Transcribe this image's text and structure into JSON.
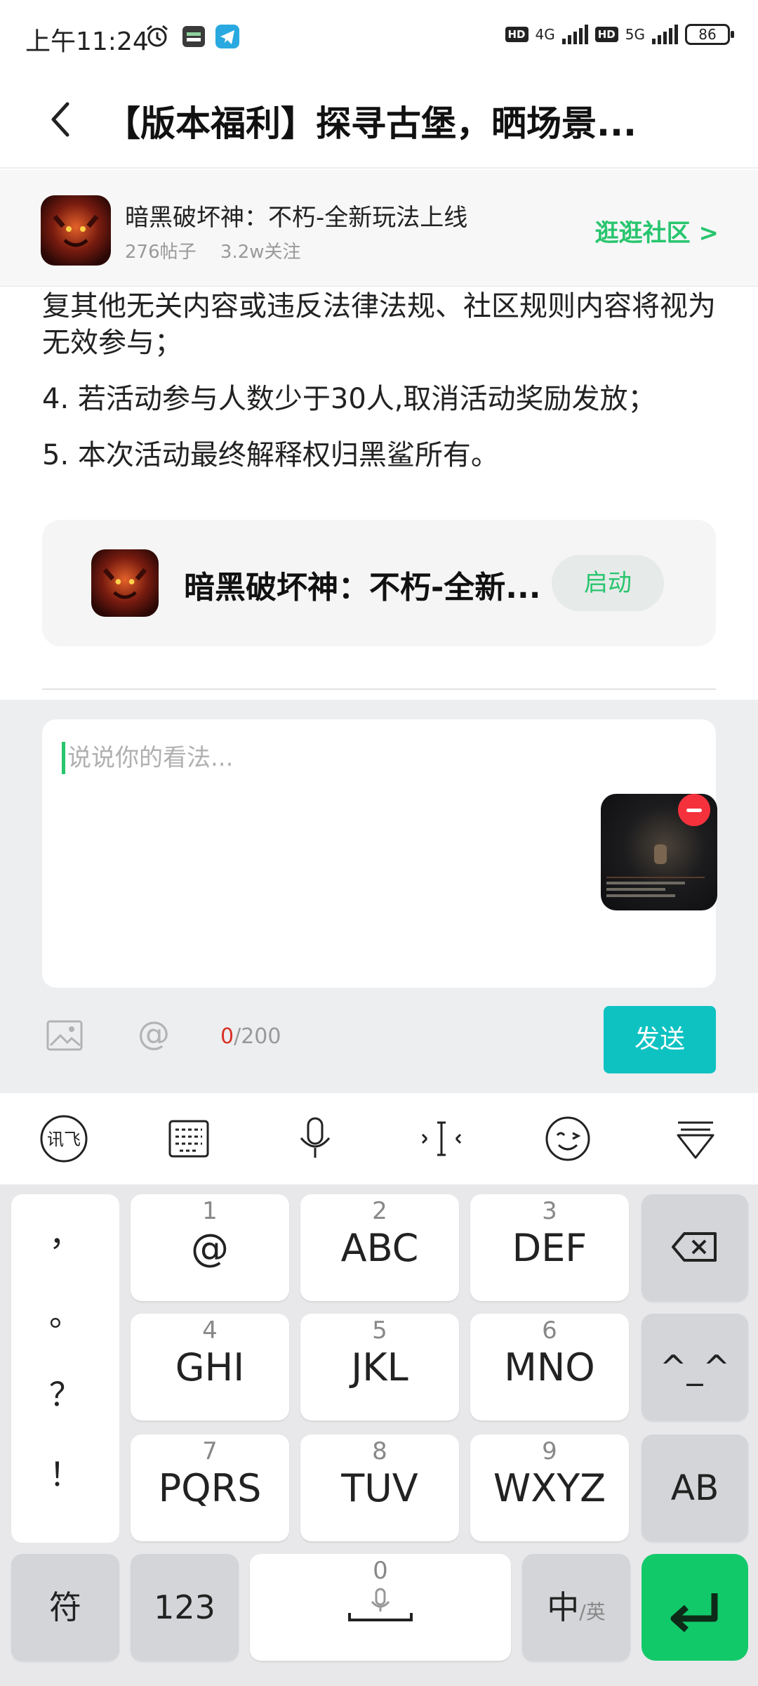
{
  "status_bar": {
    "time": "上午11:24",
    "net1": "4G",
    "net2": "5G",
    "hd": "HD",
    "battery": "86"
  },
  "header": {
    "title": "【版本福利】探寻古堡，晒场景..."
  },
  "community": {
    "name": "暗黑破坏神：不朽-全新玩法上线",
    "posts": "276帖子",
    "followers": "3.2w关注",
    "link": "逛逛社区 >"
  },
  "post": {
    "lines": [
      "复其他无关内容或违反法律法规、社区规则内容将视为无效参与；",
      "4. 若活动参与人数少于30人,取消活动奖励发放；",
      "5. 本次活动最终解释权归黑鲨所有。"
    ]
  },
  "game_card": {
    "name": "暗黑破坏神：不朽-全新...",
    "button": "启动"
  },
  "comment": {
    "placeholder": "说说你的看法...",
    "value": "",
    "count_current": "0",
    "count_max": "/200",
    "at_symbol": "@",
    "send": "发送"
  },
  "keyboard": {
    "punct": [
      "，",
      "。",
      "？",
      "！"
    ],
    "keys": [
      {
        "num": "1",
        "label": "@"
      },
      {
        "num": "2",
        "label": "ABC"
      },
      {
        "num": "3",
        "label": "DEF"
      },
      {
        "num": "4",
        "label": "GHI"
      },
      {
        "num": "5",
        "label": "JKL"
      },
      {
        "num": "6",
        "label": "MNO"
      },
      {
        "num": "7",
        "label": "PQRS"
      },
      {
        "num": "8",
        "label": "TUV"
      },
      {
        "num": "9",
        "label": "WXYZ"
      }
    ],
    "emoticon": "^_^",
    "ab": "AB",
    "symbols": "符",
    "numbers": "123",
    "space_num": "0",
    "lang_main": "中",
    "lang_alt": "/英"
  },
  "colors": {
    "accent_green": "#27c56e",
    "send_teal": "#0ec2c2",
    "enter_green": "#12c96a",
    "remove_red": "#f5323c"
  }
}
